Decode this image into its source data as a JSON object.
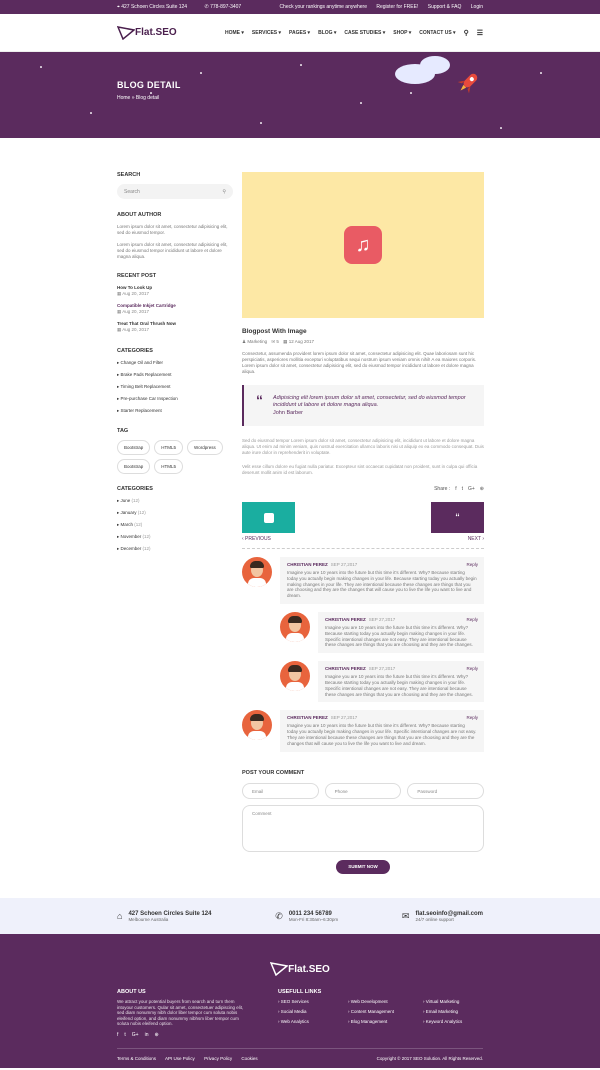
{
  "topbar": {
    "address": "427 Schoen Circles Suite 124",
    "phone": "778-897-3407",
    "links": [
      "Check your rankings anytime anywhere",
      "Register for FREE!",
      "Support & FAQ",
      "Login"
    ]
  },
  "nav": {
    "logo": "Flat.SEO",
    "items": [
      "HOME ▾",
      "SERVICES ▾",
      "PAGES ▾",
      "BLOG ▾",
      "CASE STUDIES ▾",
      "SHOP ▾",
      "CONTACT US ▾"
    ]
  },
  "hero": {
    "title": "BLOG DETAIL",
    "crumb_home": "Home",
    "crumb_sep": "»",
    "crumb_current": "Blog detail"
  },
  "sidebar": {
    "search_title": "SEARCH",
    "search_placeholder": "Search",
    "about_title": "ABOUT AUTHOR",
    "about_text": [
      "Lorem ipsum dolor sit amet, consectetur adipisicing elit, sed do eiusmod tempor.",
      "Lorem ipsum dolor sit amet, consectetur adipisicing elit, sed do eiusmod tempor incididunt ut labore et dolore magna aliqua."
    ],
    "recent_title": "RECENT POST",
    "recent": [
      {
        "title": "How To Look Up",
        "date": "Aug 20, 2017"
      },
      {
        "title": "Compatible Inkjet Cartridge",
        "date": "Aug 20, 2017"
      },
      {
        "title": "Treat That Oral Thrush Now",
        "date": "Aug 20, 2017"
      }
    ],
    "categories_title": "CATEGORIES",
    "categories": [
      "Change Oil and Filter",
      "Brake Pads Replacement",
      "Timing Belt Replacement",
      "Pre-purchase Car Inspection",
      "Starter Replacement"
    ],
    "tag_title": "TAG",
    "tags": [
      "Bootstrap",
      "HTML5",
      "Wordpress",
      "Bootstrap",
      "HTML5"
    ],
    "archive_title": "CATEGORIES",
    "archive": [
      {
        "m": "June",
        "c": "(12)"
      },
      {
        "m": "January",
        "c": "(12)"
      },
      {
        "m": "March",
        "c": "(12)"
      },
      {
        "m": "November",
        "c": "(12)"
      },
      {
        "m": "December",
        "c": "(12)"
      }
    ]
  },
  "post": {
    "title": "Blogpost With Image",
    "category": "Marketing",
    "comments": "5",
    "date": "12 Aug 2017",
    "p1": "Consectetur, assumenda provident lorem ipsum dolor sit amet, consectetur adipisicing elit. Quae laboriosam sunt hic perspiciatis, asperiores mollitia excepturi voluptatibus sequi nostrum ipsum veniam omnis nihil! A ea maiores corporis. Lorem ipsum dolor sit amet, consectetur adipisicing elit, sed do eiusmod tempor incididunt ut labore et dolore magna aliqua.",
    "quote": "Adipisicing elit lorem ipsum dolor sit amet, consectetur, sed do eiusmod tempor incididunt ut labore et dolore magna aliqua.",
    "quote_author": "John Barber",
    "p2": "Sed do eiusmod tempor Lorem ipsum dolor sit amet, consectetur adipisicing elit, incididunt ut labore et dolore magna aliqua. Ut enim ad minim veniam, quis nostrud exercitation ullamco laboris nisi ut aliquip ex ea commodo consequat. Duis aute irure dolor in reprehenderit in voluptate.",
    "p3": "Velit esse cillum dolore eu fugiat nulla pariatur. Excepteur sint occaecat cupidatat non proident, sunt in culpa qui officia deserunt mollit anim id est laborum.",
    "share": "Share :",
    "prev": "‹ PREVIOUS",
    "next": "NEXT ›"
  },
  "comments": [
    {
      "name": "CHRISTIAN PEREZ",
      "date": "SEP 27,2017",
      "reply": "Reply",
      "text": "Imagine you are 10 years into the future but this time it's different. Why? Because starting today you actually begin making changes in your life. Because starting today you actually begin making changes in your life. They are intentional because these changes are things that you are choosing and they are the changes that will cause you to live the life you want to live and dream."
    },
    {
      "name": "CHRISTIAN PEREZ",
      "date": "SEP 27,2017",
      "reply": "Reply",
      "text": "Imagine you are 10 years into the future but this time it's different. Why? Because starting today you actually begin making changes in your life. Specific intentional changes are not easy. They are intentional because these changes are things that you are choosing and they are the changes."
    },
    {
      "name": "CHRISTIAN PEREZ",
      "date": "SEP 27,2017",
      "reply": "Reply",
      "text": "Imagine you are 10 years into the future but this time it's different. Why? Because starting today you actually begin making changes in your life. Specific intentional changes are not easy. They are intentional because these changes are things that you are choosing and they are the changes."
    },
    {
      "name": "CHRISTIAN PEREZ",
      "date": "SEP 27,2017",
      "reply": "Reply",
      "text": "Imagine you are 10 years into the future but this time it's different. Why? Because starting today you actually begin making changes in your life. Specific intentional changes are not easy. They are intentional because these changes are things that you are choosing and they are the changes that will cause you to live the life you want to live and dream."
    }
  ],
  "form": {
    "title": "POST YOUR COMMENT",
    "email": "Email",
    "phone": "Phone",
    "password": "Password",
    "comment": "Comment",
    "submit": "SUBMIT NOW"
  },
  "contact": {
    "address": "427 Schoen Circles Suite 124",
    "address2": "Melbourne Australia",
    "phone": "0011 234 56789",
    "hours": "Mon-Fri 8:30am–6:30pm",
    "email": "flat.seoinfo@gmail.com",
    "support": "24/7 online support"
  },
  "footer": {
    "logo": "Flat.SEO",
    "about_title": "ABOUT US",
    "about_text": "We attract your potential buyers from search and turn them intoyour customers. Qular sit amet, consectetuer adipiscing elit, sed diam nonummy nibh dolor liber tempor cum soluta nobis eleifend option, and diam nonummy nibhsm liber tempor cum soluta nobis eleifend option.",
    "social": [
      "f",
      "t",
      "G+",
      "in",
      "⊕"
    ],
    "links_title": "USEFULL LINKS",
    "links": [
      "› SEO Services",
      "› Web Development",
      "› Virtual Marketing",
      "› Social Media",
      "› Content Management",
      "› Email Marketing",
      "› Web Analytics",
      "› Blog Management",
      "› Keyword Analytics"
    ],
    "bottom": [
      "Terms & Conditions",
      "API Use Policy",
      "Privacy Policy",
      "Cookies"
    ],
    "copyright": "Copyright © 2017 SEO Solution. All Rights Reserved."
  }
}
